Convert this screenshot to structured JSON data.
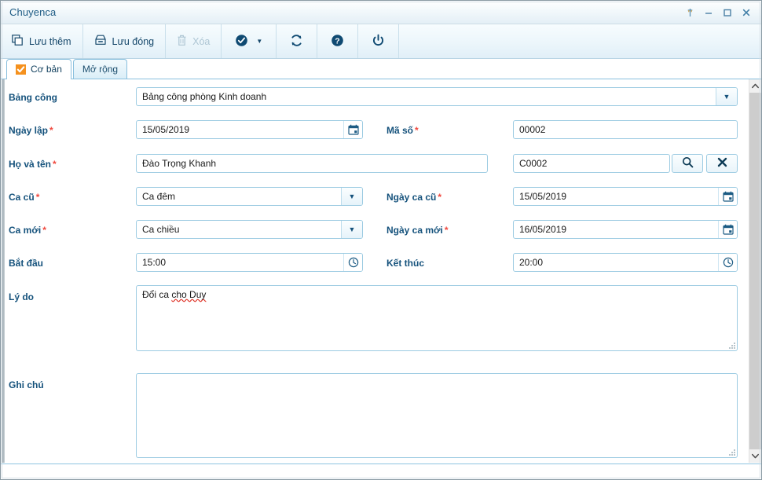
{
  "window": {
    "title": "Chuyenca",
    "controls": [
      {
        "name": "pin-button",
        "glyph": "⚲"
      },
      {
        "name": "minimize-button",
        "glyph": "–"
      },
      {
        "name": "maximize-button",
        "glyph": "❐"
      },
      {
        "name": "close-button",
        "glyph": "✕"
      }
    ]
  },
  "toolbar": {
    "save_add_label": "Lưu thêm",
    "save_close_label": "Lưu đóng",
    "delete_label": "Xóa",
    "approve_label": "",
    "refresh_label": "",
    "help_label": "",
    "power_label": "",
    "icons": {
      "save_add": "copy-icon",
      "save_close": "save-disk-icon",
      "delete": "trash-icon",
      "approve": "check-circle-icon",
      "approve_caret": "caret-down-icon",
      "refresh": "refresh-icon",
      "help": "question-circle-icon",
      "power": "power-icon"
    }
  },
  "tabs": [
    {
      "label": "Cơ bản",
      "active": true,
      "checked": true
    },
    {
      "label": "Mở rộng",
      "active": false,
      "checked": false
    }
  ],
  "form": {
    "bang_cong": {
      "label": "Bảng công",
      "required": false,
      "value": "Bảng công phòng Kinh doanh"
    },
    "ngay_lap": {
      "label": "Ngày lập",
      "required": true,
      "value": "15/05/2019"
    },
    "ma_so": {
      "label": "Mã số",
      "required": true,
      "value": "00002"
    },
    "ho_va_ten": {
      "label": "Họ và tên",
      "required": true,
      "value": "Đào Trọng Khanh"
    },
    "ma_nhan_vien": {
      "label": "",
      "required": false,
      "value": "C0002"
    },
    "ca_cu": {
      "label": "Ca cũ",
      "required": true,
      "value": "Ca đêm"
    },
    "ngay_ca_cu": {
      "label": "Ngày ca cũ",
      "required": true,
      "value": "15/05/2019"
    },
    "ca_moi": {
      "label": "Ca mới",
      "required": true,
      "value": "Ca chiều"
    },
    "ngay_ca_moi": {
      "label": "Ngày ca mới",
      "required": true,
      "value": "16/05/2019"
    },
    "bat_dau": {
      "label": "Bắt đầu",
      "required": false,
      "value": "15:00"
    },
    "ket_thuc": {
      "label": "Kết thúc",
      "required": false,
      "value": "20:00"
    },
    "ly_do": {
      "label": "Lý do",
      "required": false,
      "value_normal": "Đổi ca ",
      "value_misspelled": "cho Duy"
    },
    "ghi_chu": {
      "label": "Ghi chú",
      "required": false,
      "value": ""
    }
  },
  "colors": {
    "accent": "#15527c",
    "required_star": "#f0483e",
    "tab_check": "#f5911e",
    "field_border": "#9ccbe2",
    "spellcheck": "#e03a2f"
  }
}
